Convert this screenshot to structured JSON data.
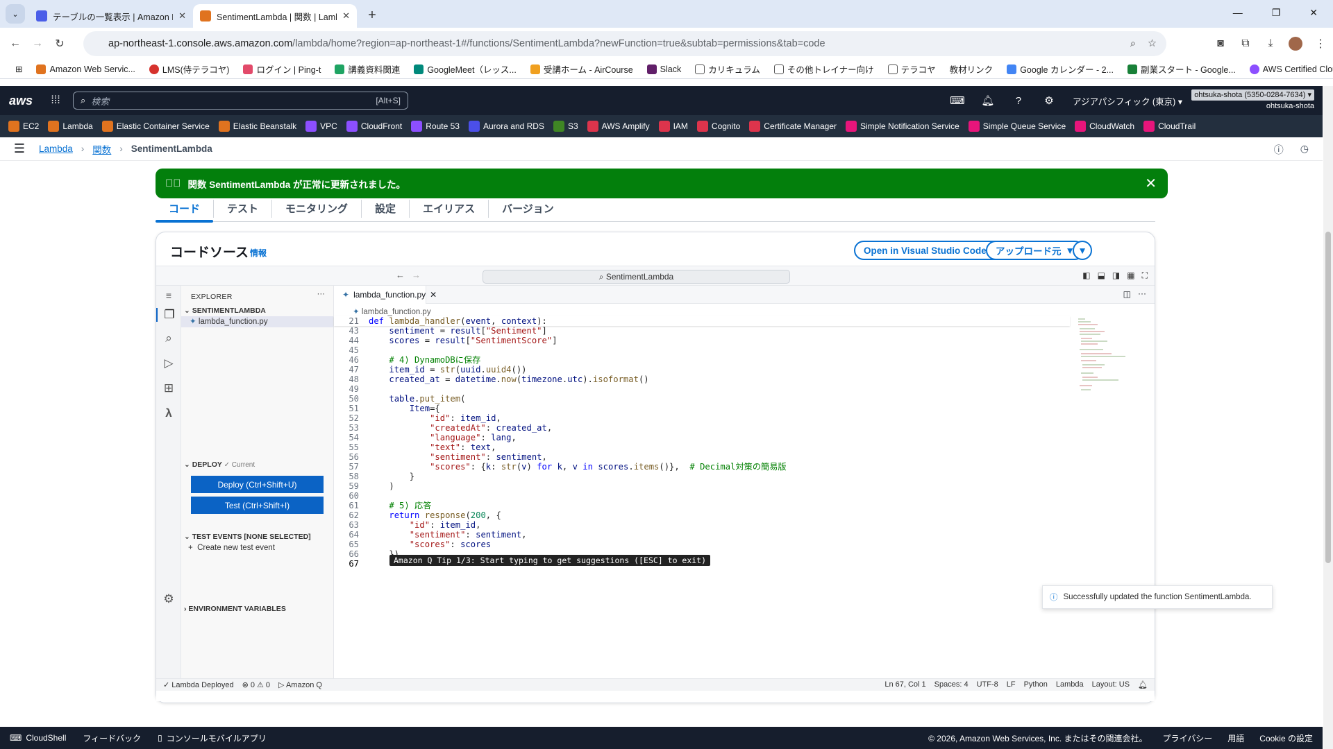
{
  "browser": {
    "tabs": [
      {
        "title": "テーブルの一覧表示 | Amazon Dy",
        "active": false
      },
      {
        "title": "SentimentLambda | 関数 | Lamb",
        "active": true
      }
    ],
    "url_host": "ap-northeast-1.console.aws.amazon.com",
    "url_path": "/lambda/home?region=ap-northeast-1#/functions/SentimentLambda?newFunction=true&subtab=permissions&tab=code",
    "bookmarks": [
      "Amazon Web Servic...",
      "LMS(侍テラコヤ)",
      "ログイン | Ping-t",
      "講義資料関連",
      "GoogleMeet（レッス...",
      "受講ホーム - AirCourse",
      "Slack",
      "カリキュラム",
      "その他トレイナー向け",
      "テラコヤ",
      "教材リンク",
      "Google カレンダー - 2...",
      "副業スタート - Google...",
      "AWS Certified Cloud..."
    ]
  },
  "aws": {
    "logo": "aws",
    "search_placeholder": "検索",
    "search_shortcut": "[Alt+S]",
    "region": "アジアパシフィック (東京) ▾",
    "account_id": "ohtsuka-shota (5350-0284-7634) ▾",
    "account_user": "ohtsuka-shota",
    "services": [
      "EC2",
      "Lambda",
      "Elastic Container Service",
      "Elastic Beanstalk",
      "VPC",
      "CloudFront",
      "Route 53",
      "Aurora and RDS",
      "S3",
      "AWS Amplify",
      "IAM",
      "Cognito",
      "Certificate Manager",
      "Simple Notification Service",
      "Simple Queue Service",
      "CloudWatch",
      "CloudTrail"
    ],
    "service_colors": [
      "#e0731f",
      "#e0731f",
      "#e0731f",
      "#e0731f",
      "#8c4fff",
      "#8c4fff",
      "#8c4fff",
      "#4b4fe8",
      "#3f8624",
      "#dd344c",
      "#dd344c",
      "#dd344c",
      "#dd344c",
      "#e7157b",
      "#e7157b",
      "#e7157b",
      "#e7157b"
    ]
  },
  "breadcrumb": {
    "root": "Lambda",
    "mid": "関数",
    "current": "SentimentLambda"
  },
  "flash": {
    "message": "関数 SentimentLambda が正常に更新されました。"
  },
  "tabs": [
    "コード",
    "テスト",
    "モニタリング",
    "設定",
    "エイリアス",
    "バージョン"
  ],
  "code_source": {
    "title": "コードソース",
    "info": "情報",
    "vscode_button": "Open in Visual Studio Code",
    "upload_button": "アップロード元"
  },
  "ide": {
    "command_center": "SentimentLambda",
    "explorer_title": "EXPLORER",
    "folder": "SENTIMENTLAMBDA",
    "file": "lambda_function.py",
    "deploy_title": "DEPLOY",
    "deploy_status": "✓ Current",
    "deploy_button": "Deploy (Ctrl+Shift+U)",
    "test_button": "Test (Ctrl+Shift+I)",
    "test_events": "TEST EVENTS [NONE SELECTED]",
    "create_event": "Create new test event",
    "env_vars": "ENVIRONMENT VARIABLES",
    "editor_tab": "lambda_function.py",
    "editor_breadcrumb": "lambda_function.py",
    "tip": "Amazon Q Tip 1/3: Start typing to get suggestions ([ESC] to exit)",
    "toast": "Successfully updated the function SentimentLambda.",
    "status_left": [
      "✓ Lambda Deployed",
      "⊗ 0 ⚠ 0",
      "▷ Amazon Q"
    ],
    "status_right": [
      "Ln 67, Col 1",
      "Spaces: 4",
      "UTF-8",
      "LF",
      "Python",
      "Lambda",
      "Layout: US"
    ]
  },
  "footer": {
    "cloudshell": "CloudShell",
    "feedback": "フィードバック",
    "mobile": "コンソールモバイルアプリ",
    "copyright": "© 2026, Amazon Web Services, Inc. またはその関連会社。",
    "privacy": "プライバシー",
    "terms": "用語",
    "cookie": "Cookie の設定"
  }
}
